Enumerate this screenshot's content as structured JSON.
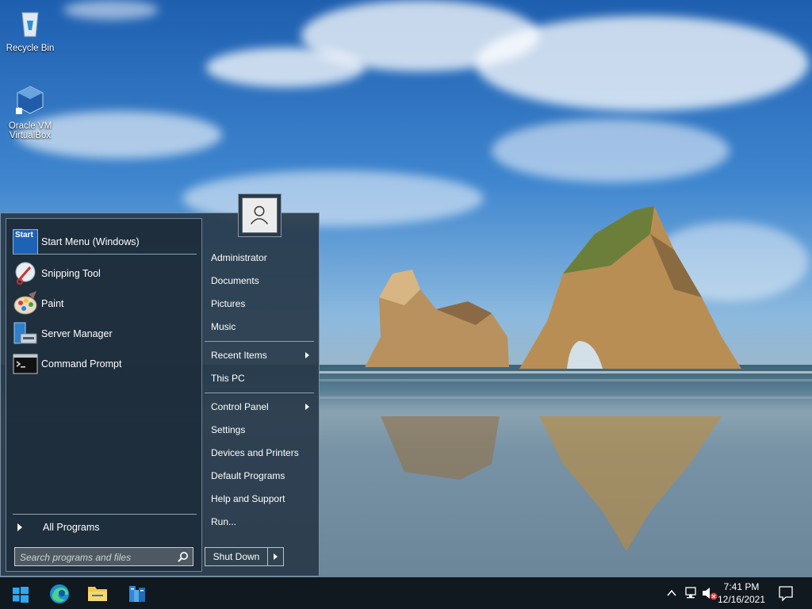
{
  "desktop": {
    "icons": [
      {
        "label": "Recycle Bin",
        "icon": "recycle-bin-icon"
      },
      {
        "label": "Oracle VM VirtualBox",
        "icon": "virtualbox-icon"
      }
    ]
  },
  "start_menu": {
    "pinned": [
      {
        "label": "Start Menu (Windows)",
        "icon": "start-menu-app-icon"
      },
      {
        "label": "Snipping Tool",
        "icon": "snipping-tool-icon"
      },
      {
        "label": "Paint",
        "icon": "paint-icon"
      },
      {
        "label": "Server Manager",
        "icon": "server-manager-icon"
      },
      {
        "label": "Command Prompt",
        "icon": "command-prompt-icon"
      }
    ],
    "start_icon_text": "Start",
    "all_programs": "All Programs",
    "search_placeholder": "Search programs and files",
    "right_items": [
      {
        "label": "Administrator",
        "submenu": false
      },
      {
        "label": "Documents",
        "submenu": false
      },
      {
        "label": "Pictures",
        "submenu": false
      },
      {
        "label": "Music",
        "submenu": false
      },
      {
        "label": "Recent Items",
        "submenu": true
      },
      {
        "label": "This PC",
        "submenu": false
      },
      {
        "label": "Control Panel",
        "submenu": true
      },
      {
        "label": "Settings",
        "submenu": false
      },
      {
        "label": "Devices and Printers",
        "submenu": false
      },
      {
        "label": "Default Programs",
        "submenu": false
      },
      {
        "label": "Help and Support",
        "submenu": false
      },
      {
        "label": "Run...",
        "submenu": false
      }
    ],
    "shutdown_label": "Shut Down"
  },
  "taskbar": {
    "apps": [
      "windows-start-icon",
      "edge-icon",
      "file-explorer-icon",
      "server-manager-icon"
    ],
    "time": "7:41 PM",
    "date": "12/16/2021",
    "colors": {
      "taskbar": "#101820",
      "accent": "#1e88e5"
    }
  }
}
